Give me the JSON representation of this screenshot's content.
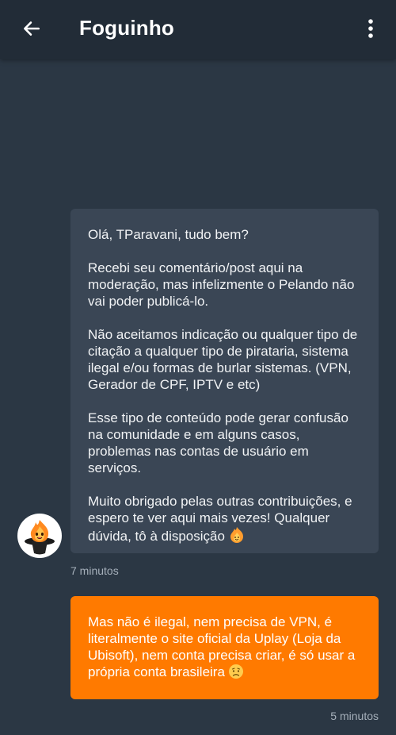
{
  "header": {
    "title": "Foguinho",
    "back_icon": "arrow-left-icon",
    "menu_icon": "more-vertical-icon"
  },
  "messages": [
    {
      "direction": "incoming",
      "paragraphs": [
        "Olá, TParavani, tudo bem?",
        "Recebi seu comentário/post  aqui na moderação, mas infelizmente o Pelando não vai poder publicá-lo.",
        "Não aceitamos indicação ou qualquer tipo de citação a qualquer tipo de pirataria, sistema ilegal e/ou formas de burlar sistemas. (VPN, Gerador de CPF, IPTV e etc)",
        "Esse tipo de conteúdo pode gerar confusão na comunidade e em alguns casos, problemas nas contas de usuário em serviços.",
        "Muito obrigado pelas outras contribuições, e espero te ver aqui mais vezes! Qualquer dúvida, tô à disposição"
      ],
      "emoji": "flame-smile-emoji",
      "time": "7 minutos"
    },
    {
      "direction": "outgoing",
      "text": "Mas não é ilegal, nem precisa de VPN, é literalmente o site oficial da Uplay (Loja da Ubisoft), nem conta precisa criar, é só usar a própria conta brasileira",
      "emoji": "worried-face-emoji",
      "time": "5 minutos"
    }
  ],
  "colors": {
    "background": "#2b3744",
    "header": "#222c37",
    "incoming_bubble": "#3a4655",
    "outgoing_bubble": "#ff7a00",
    "timestamp": "#a6b0bb"
  }
}
